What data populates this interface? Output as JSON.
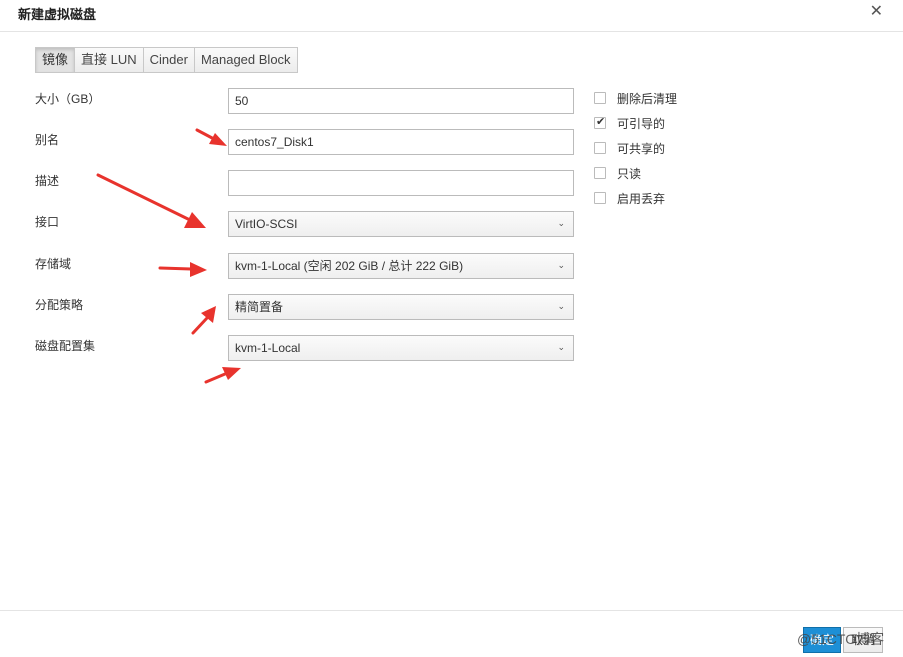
{
  "dialog": {
    "title": "新建虚拟磁盘",
    "close_glyph": "✕"
  },
  "tabs": [
    {
      "label": "镜像",
      "active": true
    },
    {
      "label": "直接 LUN",
      "active": false
    },
    {
      "label": "Cinder",
      "active": false
    },
    {
      "label": "Managed Block",
      "active": false
    }
  ],
  "form": {
    "size_label": "大小（GB）",
    "size_value": "50",
    "alias_label": "别名",
    "alias_value": "centos7_Disk1",
    "description_label": "描述",
    "description_value": "",
    "interface_label": "接口",
    "interface_value": "VirtIO-SCSI",
    "storage_domain_label": "存储域",
    "storage_domain_value": "kvm-1-Local (空闲 202 GiB / 总计 222 GiB)",
    "allocation_label": "分配策略",
    "allocation_value": "精简置备",
    "disk_profile_label": "磁盘配置集",
    "disk_profile_value": "kvm-1-Local"
  },
  "checkboxes": [
    {
      "label": "删除后清理",
      "checked": false
    },
    {
      "label": "可引导的",
      "checked": true
    },
    {
      "label": "可共享的",
      "checked": false
    },
    {
      "label": "只读",
      "checked": false
    },
    {
      "label": "启用丢弃",
      "checked": false
    }
  ],
  "footer": {
    "ok_label": "确定",
    "cancel_label": "取消"
  },
  "watermark": "@51CTO博客",
  "annotation_color": "#e8332d",
  "accent_color": "#1d8fd6"
}
